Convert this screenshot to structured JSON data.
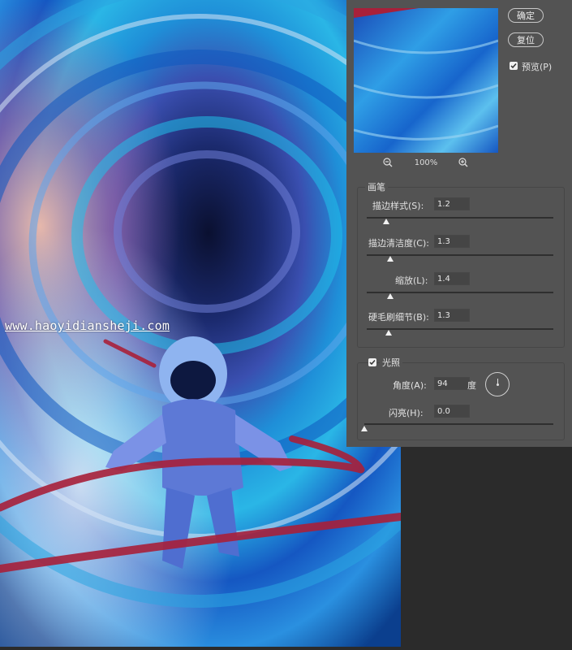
{
  "canvas": {
    "watermark": "www.haoyidiansheji.com"
  },
  "preview": {
    "zoom_level": "100%"
  },
  "buttons": {
    "ok_label": "确定",
    "reset_label": "复位"
  },
  "preview_toggle": {
    "label": "预览(P)",
    "checked": true
  },
  "brush_group": {
    "title": "画笔",
    "params": [
      {
        "label": "描边样式(S):",
        "value": "1.2",
        "slider_fraction": 0.09
      },
      {
        "label": "描边清洁度(C):",
        "value": "1.3",
        "slider_fraction": 0.12
      },
      {
        "label": "缩放(L):",
        "value": "1.4",
        "slider_fraction": 0.14
      },
      {
        "label": "硬毛刷细节(B):",
        "value": "1.3",
        "slider_fraction": 0.12
      }
    ]
  },
  "lighting_group": {
    "title": "光照",
    "checked": true,
    "angle_label": "角度(A):",
    "angle_value": "94",
    "angle_unit": "度",
    "shine_label": "闪亮(H):",
    "shine_value": "0.0",
    "shine_slider_fraction": 0.0
  },
  "colors": {
    "panel_bg": "#535353",
    "app_bg": "#2b2b2b",
    "field_bg": "#454545",
    "text": "#e2e2e2"
  }
}
